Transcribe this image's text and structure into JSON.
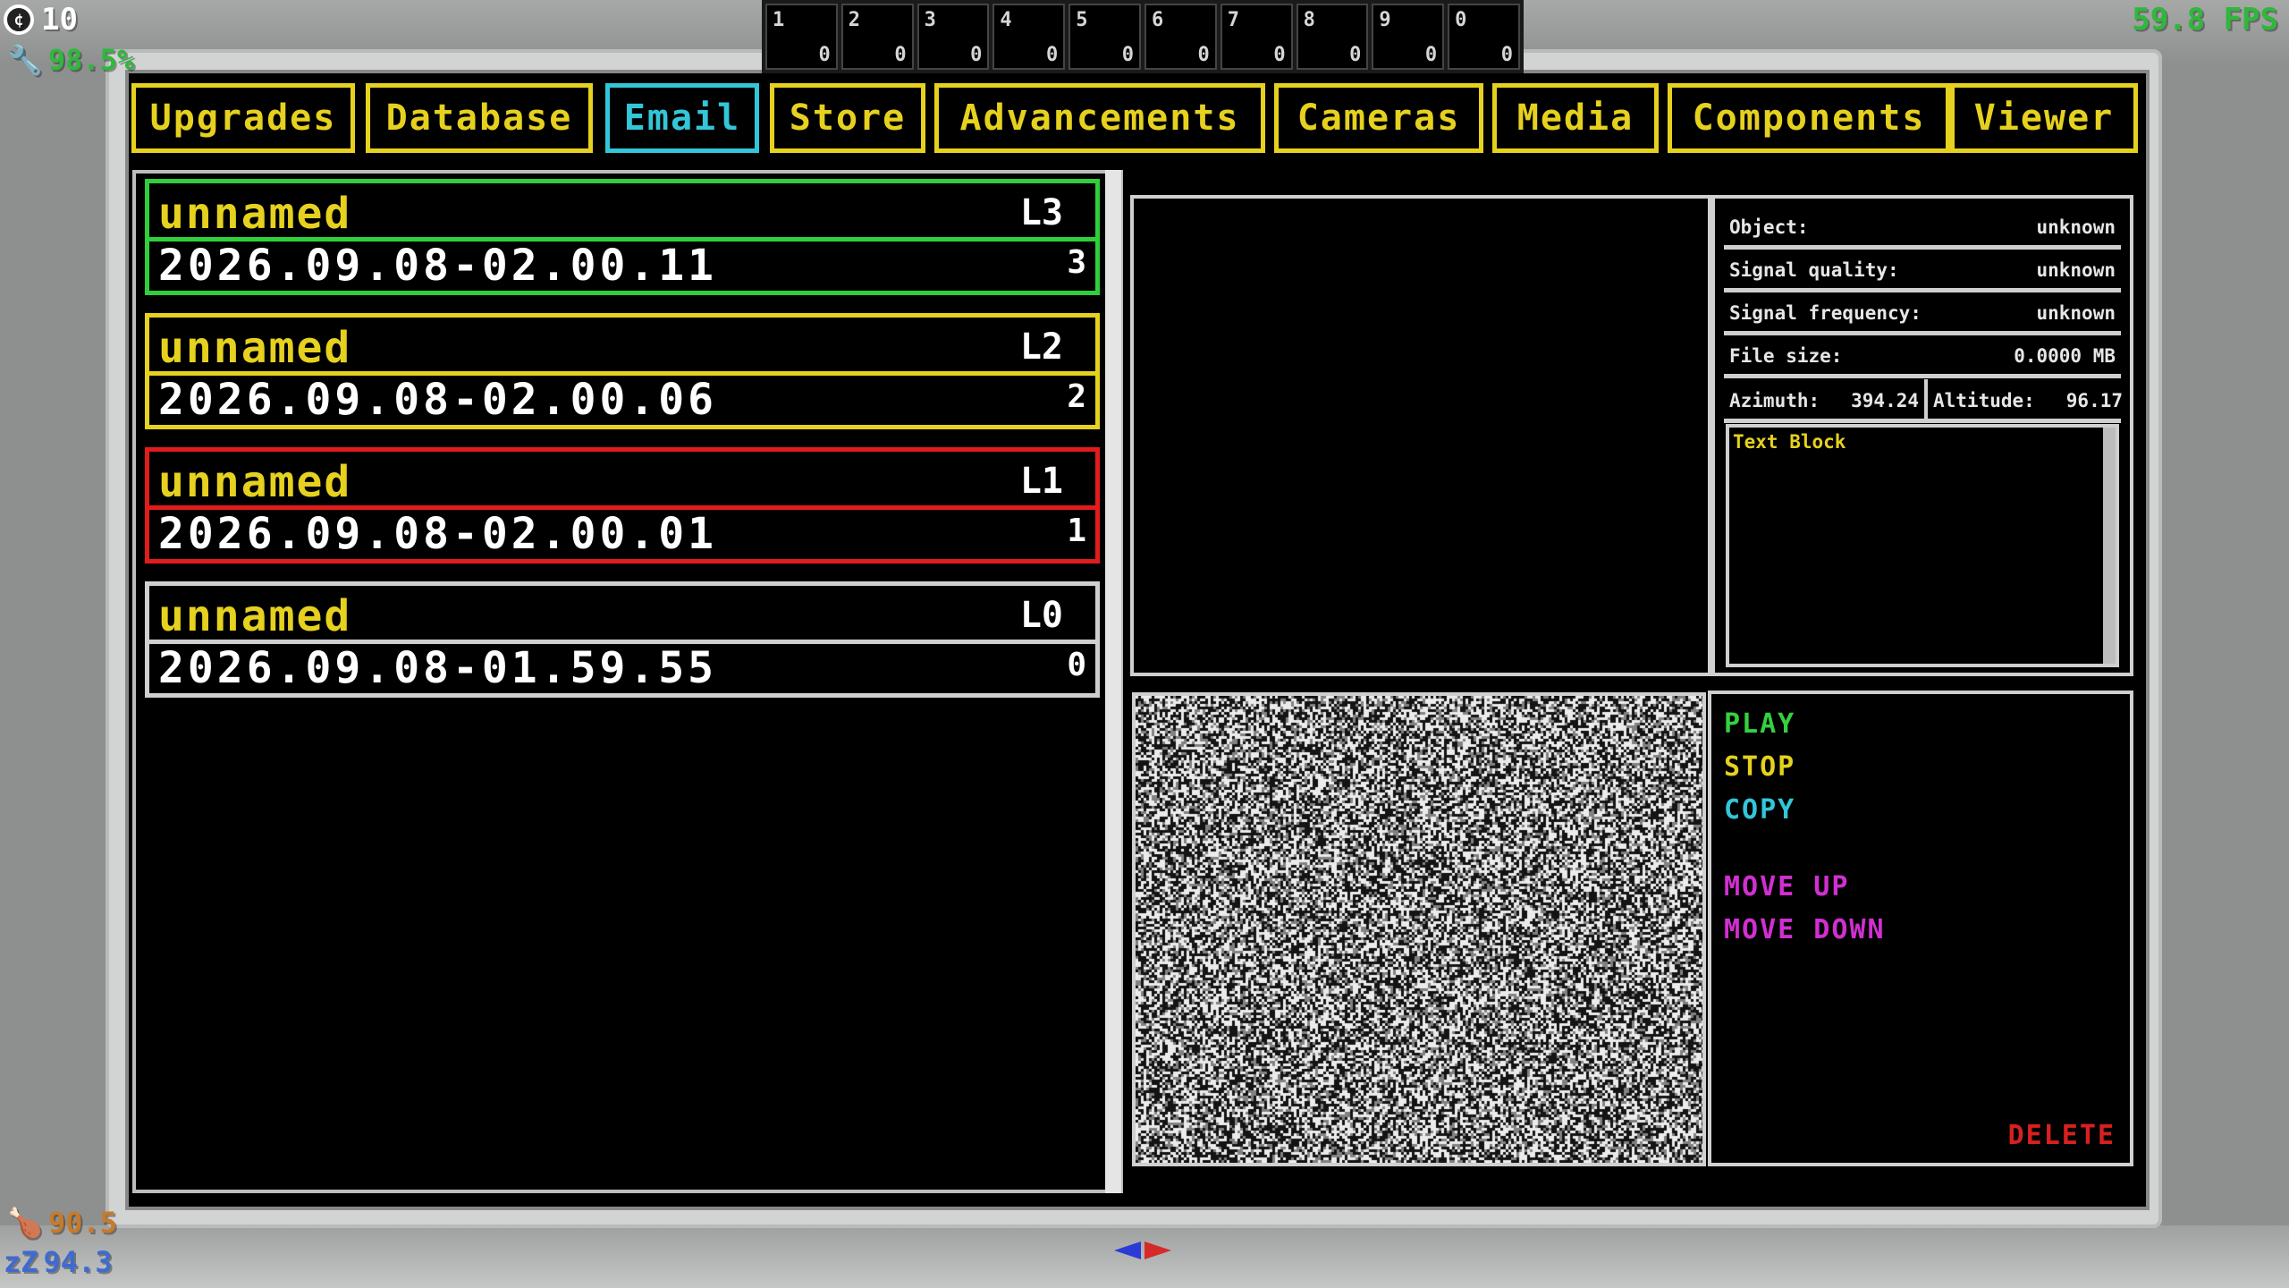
{
  "hud": {
    "credits": "10",
    "health": "98.5%",
    "fps": "59.8 FPS",
    "food": "90.5",
    "sleep": "94.3",
    "sleep_icon": "zZ"
  },
  "hotbar": [
    {
      "slot": "1",
      "count": "0"
    },
    {
      "slot": "2",
      "count": "0"
    },
    {
      "slot": "3",
      "count": "0"
    },
    {
      "slot": "4",
      "count": "0"
    },
    {
      "slot": "5",
      "count": "0"
    },
    {
      "slot": "6",
      "count": "0"
    },
    {
      "slot": "7",
      "count": "0"
    },
    {
      "slot": "8",
      "count": "0"
    },
    {
      "slot": "9",
      "count": "0"
    },
    {
      "slot": "0",
      "count": "0"
    }
  ],
  "tabs": [
    "Upgrades",
    "Database",
    "Email",
    "Store",
    "Advancements",
    "Cameras",
    "Media",
    "Components",
    "Viewer"
  ],
  "active_tab": "Email",
  "emails": [
    {
      "subject": "unnamed",
      "level": "L3",
      "date": "2026.09.08-02.00.11",
      "index": "3",
      "color": "#2fcf3c"
    },
    {
      "subject": "unnamed",
      "level": "L2",
      "date": "2026.09.08-02.00.06",
      "index": "2",
      "color": "#e5d11e"
    },
    {
      "subject": "unnamed",
      "level": "L1",
      "date": "2026.09.08-02.00.01",
      "index": "1",
      "color": "#e21c1c"
    },
    {
      "subject": "unnamed",
      "level": "L0",
      "date": "2026.09.08-01.59.55",
      "index": "0",
      "color": "#cfcfcf"
    }
  ],
  "info": {
    "object_label": "Object:",
    "object_value": "unknown",
    "signal_quality_label": "Signal quality:",
    "signal_quality_value": "unknown",
    "signal_frequency_label": "Signal frequency:",
    "signal_frequency_value": "unknown",
    "file_size_label": "File size:",
    "file_size_value": "0.0000 MB",
    "azimuth_label": "Azimuth:",
    "azimuth_value": "394.24",
    "altitude_label": "Altitude:",
    "altitude_value": "96.17",
    "text_block_label": "Text Block"
  },
  "controls": {
    "play": "PLAY",
    "stop": "STOP",
    "copy": "COPY",
    "move_up": "MOVE UP",
    "move_down": "MOVE DOWN",
    "delete": "DELETE"
  },
  "colors": {
    "accent_yellow": "#e5d11e",
    "active_cyan": "#33c6d8",
    "green": "#34d13f",
    "magenta": "#d12fd1",
    "red": "#d82020"
  }
}
